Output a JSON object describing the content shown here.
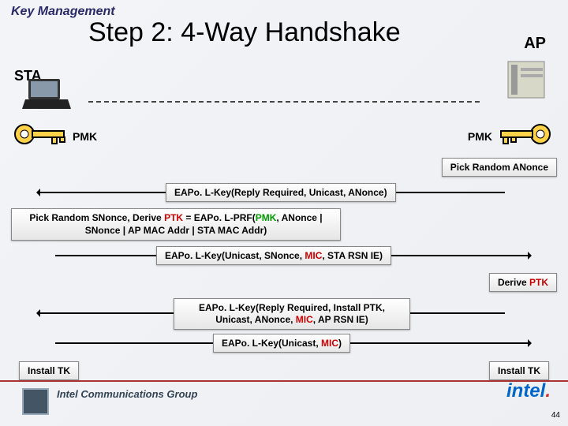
{
  "breadcrumb": "Key Management",
  "title": "Step 2: 4-Way Handshake",
  "labels": {
    "sta": "STA",
    "ap": "AP",
    "pmk_left": "PMK",
    "pmk_right": "PMK"
  },
  "boxes": {
    "pick_anonce": "Pick Random ANonce",
    "msg1": "EAPo. L-Key(Reply Required, Unicast, ANonce)",
    "derive_snonce_pre": "Pick Random SNonce, Derive ",
    "derive_snonce_ptk": "PTK",
    "derive_snonce_eq": " = EAPo. L-PRF(",
    "derive_snonce_pmk": "PMK",
    "derive_snonce_post": ", ANonce | SNonce | AP MAC Addr | STA MAC Addr)",
    "msg2_pre": "EAPo. L-Key(Unicast, SNonce, ",
    "msg2_mic": "MIC",
    "msg2_post": ", STA RSN IE)",
    "derive_ptk_pre": "Derive ",
    "derive_ptk_ptk": "PTK",
    "msg3_pre": "EAPo. L-Key(Reply Required, Install PTK, Unicast, ANonce, ",
    "msg3_mic": "MIC",
    "msg3_post": ", AP RSN IE)",
    "msg4_pre": "EAPo. L-Key(Unicast, ",
    "msg4_mic": "MIC",
    "msg4_post": ")",
    "install_tk_left": "Install TK",
    "install_tk_right": "Install TK"
  },
  "footer": {
    "group": "Intel Communications Group",
    "logo": "intel",
    "dot": "."
  },
  "page_number": "44"
}
